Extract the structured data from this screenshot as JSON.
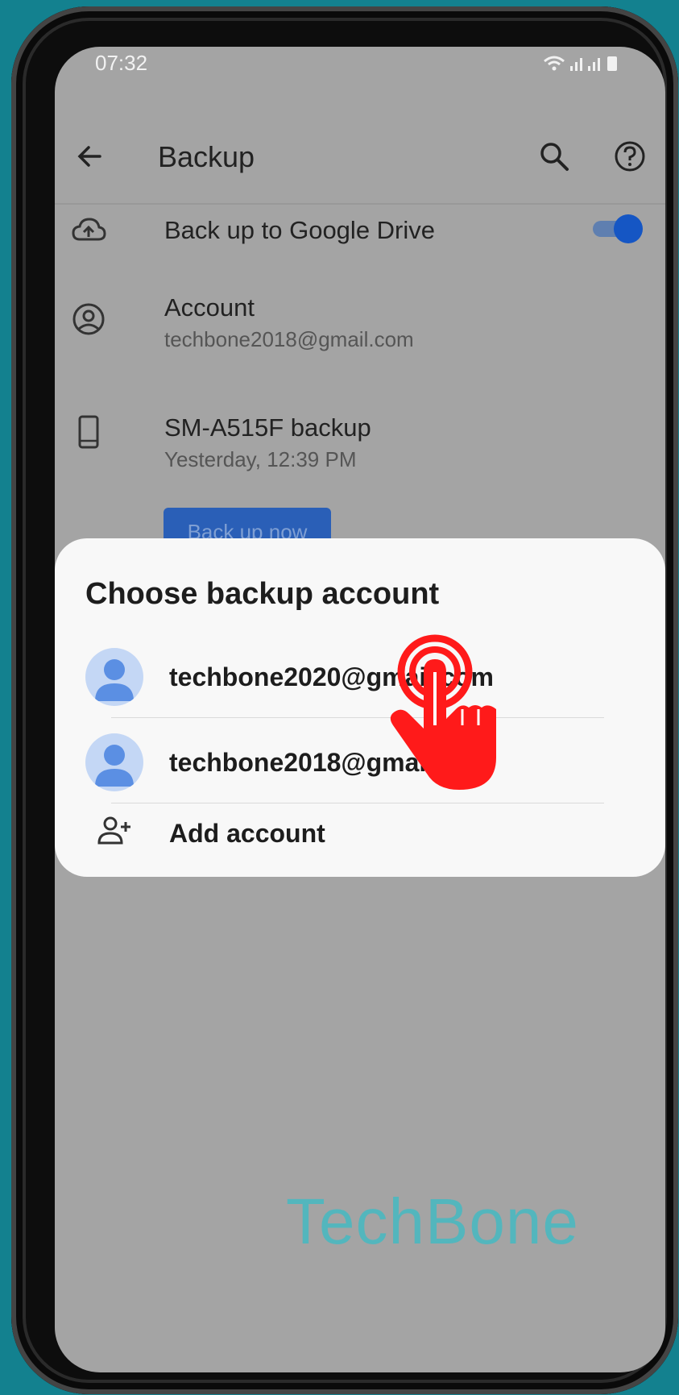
{
  "status_bar": {
    "time": "07:32",
    "icons": "wifi-icon signal-icon signal-icon battery-icon"
  },
  "appbar": {
    "title": "Backup",
    "back_icon": "arrow-left-icon",
    "search_icon": "search-icon",
    "help_icon": "help-circle-icon"
  },
  "settings": {
    "drive": {
      "label": "Back up to Google Drive",
      "icon": "cloud-upload-icon",
      "toggle_on": true
    },
    "account": {
      "label": "Account",
      "value": "techbone2018@gmail.com",
      "icon": "account-circle-icon"
    },
    "device": {
      "label": "SM-A515F backup",
      "value": "Yesterday, 12:39 PM",
      "icon": "phone-icon"
    },
    "backup_button": "Back up now"
  },
  "dialog": {
    "title": "Choose backup account",
    "accounts": [
      {
        "email": "techbone2020@gmail.com"
      },
      {
        "email": "techbone2018@gmail.com"
      }
    ],
    "add_account": "Add account"
  },
  "watermark": "TechBone",
  "colors": {
    "background": "#13818f",
    "accent": "#1556c4",
    "overlay_hand": "#ff1a1a",
    "watermark": "#4bb8c0"
  }
}
